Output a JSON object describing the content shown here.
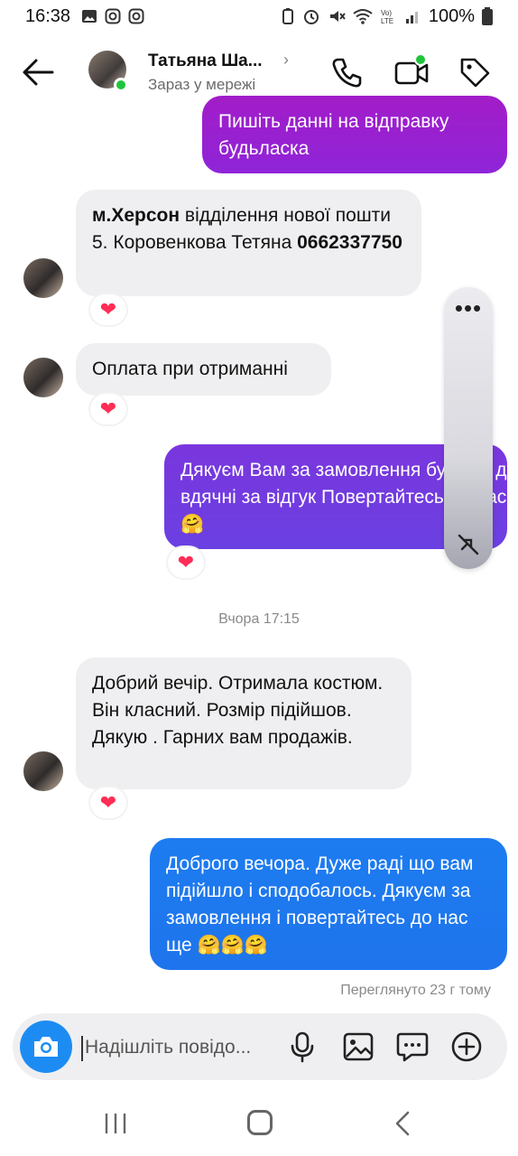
{
  "status_bar": {
    "time": "16:38",
    "battery": "100%"
  },
  "header": {
    "contact_name": "Татьяна Ша...",
    "status": "Зараз у мережі"
  },
  "messages": [
    {
      "direction": "out",
      "text": "Пишіть данні на відправку будьласка"
    },
    {
      "direction": "in",
      "bold_start": "м.Херсон",
      "text": " відділення нової пошти 5. Коровенкова  Тетяна ",
      "bold_end": "0662337750",
      "reaction": "heart"
    },
    {
      "direction": "in",
      "text": "Оплата при отриманні",
      "reaction": "heart"
    },
    {
      "direction": "out",
      "text": "Дякуєм Вам  за замовлення будемо дуже вдячні за відгук Повертайтесь до нас ще.🤗",
      "reaction": "heart"
    },
    {
      "direction": "in",
      "text": "Добрий вечір. Отримала костюм. Він класний. Розмір підійшов. Дякую . Гарних вам продажів.",
      "reaction": "heart"
    },
    {
      "direction": "out",
      "text": "Доброго вечора. Дуже раді що вам підійшло і сподобалось. Дякуєм за замовлення і повертайтесь до нас ще 🤗🤗🤗"
    }
  ],
  "timestamp": "Вчора 17:15",
  "seen_status": "Переглянуто 23 г тому",
  "composer": {
    "placeholder": "Надішліть повідо..."
  },
  "floating_panel": {
    "menu_label": "•••"
  },
  "colors": {
    "bubble_purple": "#9a1fd0",
    "bubble_violet": "#6a3ee0",
    "bubble_blue": "#1e78ee",
    "incoming_gray": "#efeff1",
    "accent_blue": "#1d8cf2",
    "online_green": "#1fc43b",
    "heart_red": "#ff2d55"
  },
  "icons": [
    "back-arrow-icon",
    "phone-icon",
    "video-call-icon",
    "tag-icon",
    "camera-icon",
    "microphone-icon",
    "gallery-icon",
    "sticker-icon",
    "plus-icon",
    "pip-off-icon"
  ]
}
